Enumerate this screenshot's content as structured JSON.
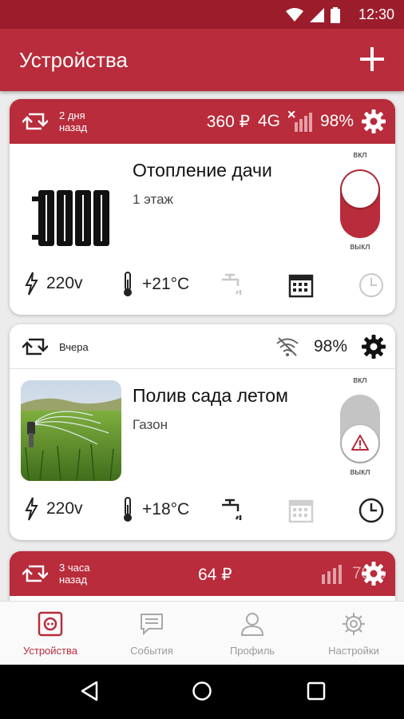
{
  "status_bar": {
    "time": "12:30",
    "icons": [
      "wifi-icon",
      "signal-icon",
      "battery-icon"
    ]
  },
  "app_bar": {
    "title": "Устройства",
    "add_icon": "plus-icon"
  },
  "colors": {
    "brand": "#b82c3b",
    "status_bar": "#9b1d2c",
    "inactive": "#bdbdbd"
  },
  "devices": [
    {
      "updated": "2 дня\nназад",
      "balance": "360 ₽",
      "network": "4G",
      "battery": "98%",
      "name": "Отопление дачи",
      "location": "1 этаж",
      "switch_on_label": "вкл",
      "switch_off_label": "выкл",
      "switch_state": "on",
      "voltage": "220v",
      "temperature": "+21°C",
      "icons": [
        "radiator-icon",
        "faucet-icon",
        "calendar-icon",
        "clock-icon"
      ]
    },
    {
      "updated": "Вчера",
      "battery": "98%",
      "name": "Полив сада летом",
      "location": "Газон",
      "switch_on_label": "вкл",
      "switch_off_label": "выкл",
      "switch_state": "off",
      "voltage": "220v",
      "temperature": "+18°C",
      "icons": [
        "sprinkler-photo",
        "no-wifi-icon",
        "warning-icon",
        "faucet-icon",
        "calendar-icon",
        "clock-icon"
      ]
    },
    {
      "updated": "3 часа\nназад",
      "balance": "64 ₽",
      "battery": "79%"
    }
  ],
  "bottom_nav": [
    {
      "label": "Устройства",
      "icon": "device-icon",
      "active": true
    },
    {
      "label": "События",
      "icon": "chat-icon",
      "active": false
    },
    {
      "label": "Профиль",
      "icon": "person-icon",
      "active": false
    },
    {
      "label": "Настройки",
      "icon": "gear-icon",
      "active": false
    }
  ]
}
